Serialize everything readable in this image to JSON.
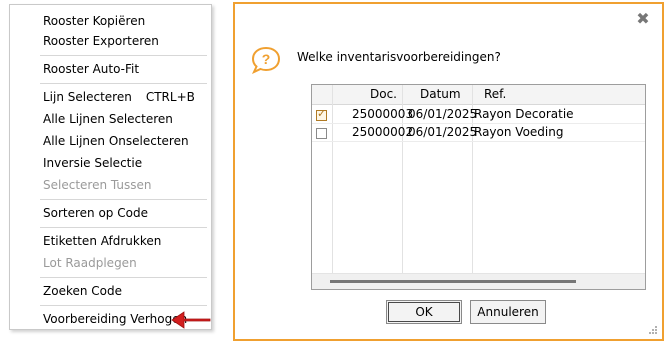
{
  "context_menu": {
    "items": [
      {
        "label": "Rooster Kopiëren",
        "disabled": false
      },
      {
        "label": "Rooster Exporteren",
        "disabled": false
      },
      {
        "label": "Rooster Auto-Fit",
        "disabled": false
      },
      {
        "label": "Lijn Selecteren",
        "shortcut": "CTRL+B",
        "disabled": false
      },
      {
        "label": "Alle Lijnen Selecteren",
        "disabled": false
      },
      {
        "label": "Alle Lijnen Onselecteren",
        "disabled": false
      },
      {
        "label": "Inversie Selectie",
        "disabled": false
      },
      {
        "label": "Selecteren Tussen",
        "disabled": true
      },
      {
        "label": "Sorteren op Code",
        "disabled": false
      },
      {
        "label": "Etiketten Afdrukken",
        "disabled": false
      },
      {
        "label": "Lot Raadplegen",
        "disabled": true
      },
      {
        "label": "Zoeken Code",
        "disabled": false
      },
      {
        "label": "Voorbereiding Verhogen",
        "disabled": false
      }
    ]
  },
  "dialog": {
    "question": "Welke inventarisvoorbereidingen?",
    "columns": [
      "Doc.",
      "Datum",
      "Ref."
    ],
    "rows": [
      {
        "checked": true,
        "doc": "25000003",
        "datum": "06/01/2025",
        "ref": "Rayon Decoratie"
      },
      {
        "checked": false,
        "doc": "25000002",
        "datum": "06/01/2025",
        "ref": "Rayon Voeding"
      }
    ],
    "ok_label": "OK",
    "cancel_label": "Annuleren",
    "close_glyph": "✖"
  },
  "colors": {
    "dialog_border": "#f0a030",
    "arrow": "#d31f1f",
    "question_icon": "#f0a030"
  }
}
